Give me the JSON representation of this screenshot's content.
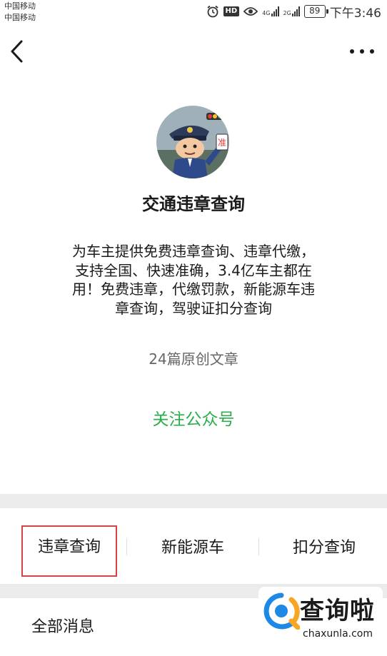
{
  "status_bar": {
    "carrier_1": "中国移动",
    "carrier_2": "中国移动",
    "hd": "HD",
    "network_1": "4G",
    "network_2": "2G",
    "battery": "89",
    "time": "下午3:46"
  },
  "nav": {
    "back_icon": "chevron-left-icon",
    "more_icon": "more-dots-icon"
  },
  "profile": {
    "name": "交通违章查询",
    "description_lines": [
      "为车主提供免费违章查询、违章代缴，",
      "支持全国、快速准确，3.4亿车主都在",
      "用！免费违章，代缴罚款，新能源车违",
      "章查询，驾驶证扣分查询"
    ],
    "article_count": "24篇原创文章",
    "follow_label": "关注公众号"
  },
  "menu": {
    "items": [
      {
        "label": "违章查询",
        "highlighted": true
      },
      {
        "label": "新能源车",
        "highlighted": false
      },
      {
        "label": "扣分查询",
        "highlighted": false
      }
    ]
  },
  "messages": {
    "section_label": "全部消息"
  },
  "watermark": {
    "title": "查询啦",
    "url": "chaxunla.com"
  },
  "colors": {
    "follow_green": "#2aae4c",
    "highlight_red": "#d64545",
    "divider_gray": "#ebebeb",
    "watermark_blue": "#1e88e5",
    "watermark_orange": "#f5a623"
  }
}
